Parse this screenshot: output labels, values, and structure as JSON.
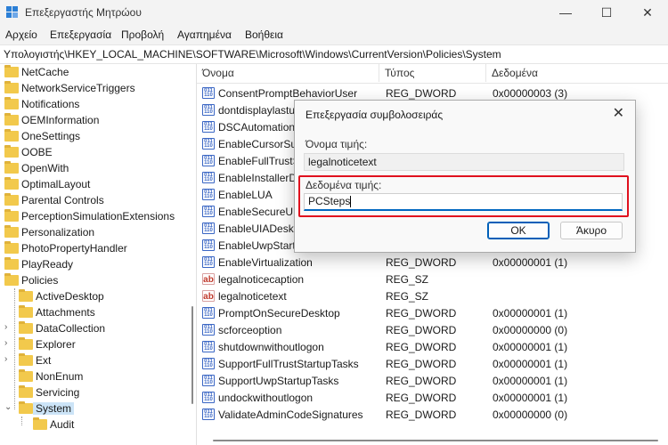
{
  "window": {
    "title": "Επεξεργαστής Μητρώου",
    "minimize": "—",
    "maximize": "☐",
    "close": "✕"
  },
  "menu": [
    "Αρχείο",
    "Επεξεργασία",
    "Προβολή",
    "Αγαπημένα",
    "Βοήθεια"
  ],
  "address": "Υπολογιστής\\HKEY_LOCAL_MACHINE\\SOFTWARE\\Microsoft\\Windows\\CurrentVersion\\Policies\\System",
  "tree": {
    "items": [
      {
        "label": "NetCache"
      },
      {
        "label": "NetworkServiceTriggers"
      },
      {
        "label": "Notifications"
      },
      {
        "label": "OEMInformation"
      },
      {
        "label": "OneSettings"
      },
      {
        "label": "OOBE"
      },
      {
        "label": "OpenWith"
      },
      {
        "label": "OptimalLayout"
      },
      {
        "label": "Parental Controls"
      },
      {
        "label": "PerceptionSimulationExtensions"
      },
      {
        "label": "Personalization"
      },
      {
        "label": "PhotoPropertyHandler"
      },
      {
        "label": "PlayReady"
      },
      {
        "label": "Policies"
      },
      {
        "label": "ActiveDesktop"
      },
      {
        "label": "Attachments"
      },
      {
        "label": "DataCollection"
      },
      {
        "label": "Explorer"
      },
      {
        "label": "Ext"
      },
      {
        "label": "NonEnum"
      },
      {
        "label": "Servicing"
      },
      {
        "label": "System"
      },
      {
        "label": "Audit"
      }
    ]
  },
  "values": {
    "headers": {
      "name": "Όνομα",
      "type": "Τύπος",
      "data": "Δεδομένα"
    },
    "rows": [
      {
        "icon": "binary-value-icon",
        "name": "ConsentPromptBehaviorUser",
        "type": "REG_DWORD",
        "data": "0x00000003 (3)"
      },
      {
        "icon": "binary-value-icon",
        "name": "dontdisplaylastus",
        "type": "",
        "data": ""
      },
      {
        "icon": "binary-value-icon",
        "name": "DSCAutomationH",
        "type": "",
        "data": ""
      },
      {
        "icon": "binary-value-icon",
        "name": "EnableCursorSup",
        "type": "",
        "data": ""
      },
      {
        "icon": "binary-value-icon",
        "name": "EnableFullTrustSt",
        "type": "",
        "data": ""
      },
      {
        "icon": "binary-value-icon",
        "name": "EnableInstallerDe",
        "type": "",
        "data": ""
      },
      {
        "icon": "binary-value-icon",
        "name": "EnableLUA",
        "type": "",
        "data": ""
      },
      {
        "icon": "binary-value-icon",
        "name": "EnableSecureUIA",
        "type": "",
        "data": ""
      },
      {
        "icon": "binary-value-icon",
        "name": "EnableUIADeskto",
        "type": "",
        "data": ""
      },
      {
        "icon": "binary-value-icon",
        "name": "EnableUwpStartup",
        "type": "",
        "data": ""
      },
      {
        "icon": "binary-value-icon",
        "name": "EnableVirtualization",
        "type": "REG_DWORD",
        "data": "0x00000001 (1)"
      },
      {
        "icon": "string-value-icon",
        "name": "legalnoticecaption",
        "type": "REG_SZ",
        "data": ""
      },
      {
        "icon": "string-value-icon",
        "name": "legalnoticetext",
        "type": "REG_SZ",
        "data": ""
      },
      {
        "icon": "binary-value-icon",
        "name": "PromptOnSecureDesktop",
        "type": "REG_DWORD",
        "data": "0x00000001 (1)"
      },
      {
        "icon": "binary-value-icon",
        "name": "scforceoption",
        "type": "REG_DWORD",
        "data": "0x00000000 (0)"
      },
      {
        "icon": "binary-value-icon",
        "name": "shutdownwithoutlogon",
        "type": "REG_DWORD",
        "data": "0x00000001 (1)"
      },
      {
        "icon": "binary-value-icon",
        "name": "SupportFullTrustStartupTasks",
        "type": "REG_DWORD",
        "data": "0x00000001 (1)"
      },
      {
        "icon": "binary-value-icon",
        "name": "SupportUwpStartupTasks",
        "type": "REG_DWORD",
        "data": "0x00000001 (1)"
      },
      {
        "icon": "binary-value-icon",
        "name": "undockwithoutlogon",
        "type": "REG_DWORD",
        "data": "0x00000001 (1)"
      },
      {
        "icon": "binary-value-icon",
        "name": "ValidateAdminCodeSignatures",
        "type": "REG_DWORD",
        "data": "0x00000000 (0)"
      }
    ]
  },
  "dialog": {
    "title": "Επεξεργασία συμβολοσειράς",
    "close": "✕",
    "value_name_label": "Όνομα τιμής:",
    "value_name": "legalnoticetext",
    "value_data_label": "Δεδομένα τιμής:",
    "value_data": "PCSteps",
    "ok_label": "OK",
    "cancel_label": "Άκυρο"
  },
  "colors": {
    "highlight": "#e0101e",
    "accent": "#0067c0",
    "selection": "#cce4f7",
    "folder": "#f2c94c"
  }
}
